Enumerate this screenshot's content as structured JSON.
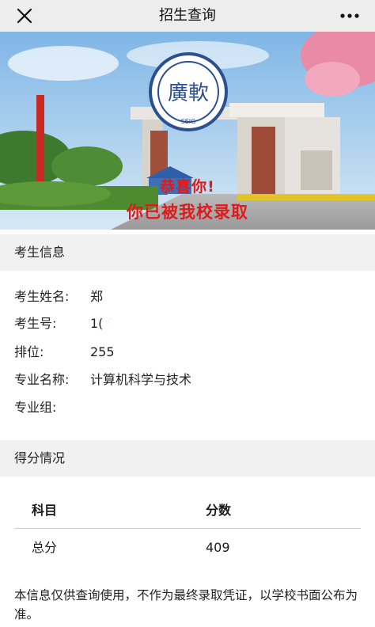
{
  "navbar": {
    "title": "招生查询",
    "close_icon": "close-icon",
    "more_icon": "more-dots-icon"
  },
  "banner": {
    "line1": "恭喜你!",
    "line2": "你已被我校录取",
    "logo_text": "SEIG",
    "text_color": "#e01a1a"
  },
  "candidate_section": {
    "title": "考生信息",
    "rows": [
      {
        "label": "考生姓名:",
        "value": "郑"
      },
      {
        "label": "考生号:",
        "value": "1(                9"
      },
      {
        "label": "排位:",
        "value": "255"
      },
      {
        "label": "专业名称:",
        "value": "计算机科学与技术"
      },
      {
        "label": "专业组:",
        "value": ""
      }
    ]
  },
  "score_section": {
    "title": "得分情况",
    "headers": {
      "subject": "科目",
      "score": "分数"
    },
    "rows": [
      {
        "subject": "总分",
        "score": "409"
      }
    ]
  },
  "footnote": "本信息仅供查询使用，不作为最终录取凭证，以学校书面公布为准。"
}
